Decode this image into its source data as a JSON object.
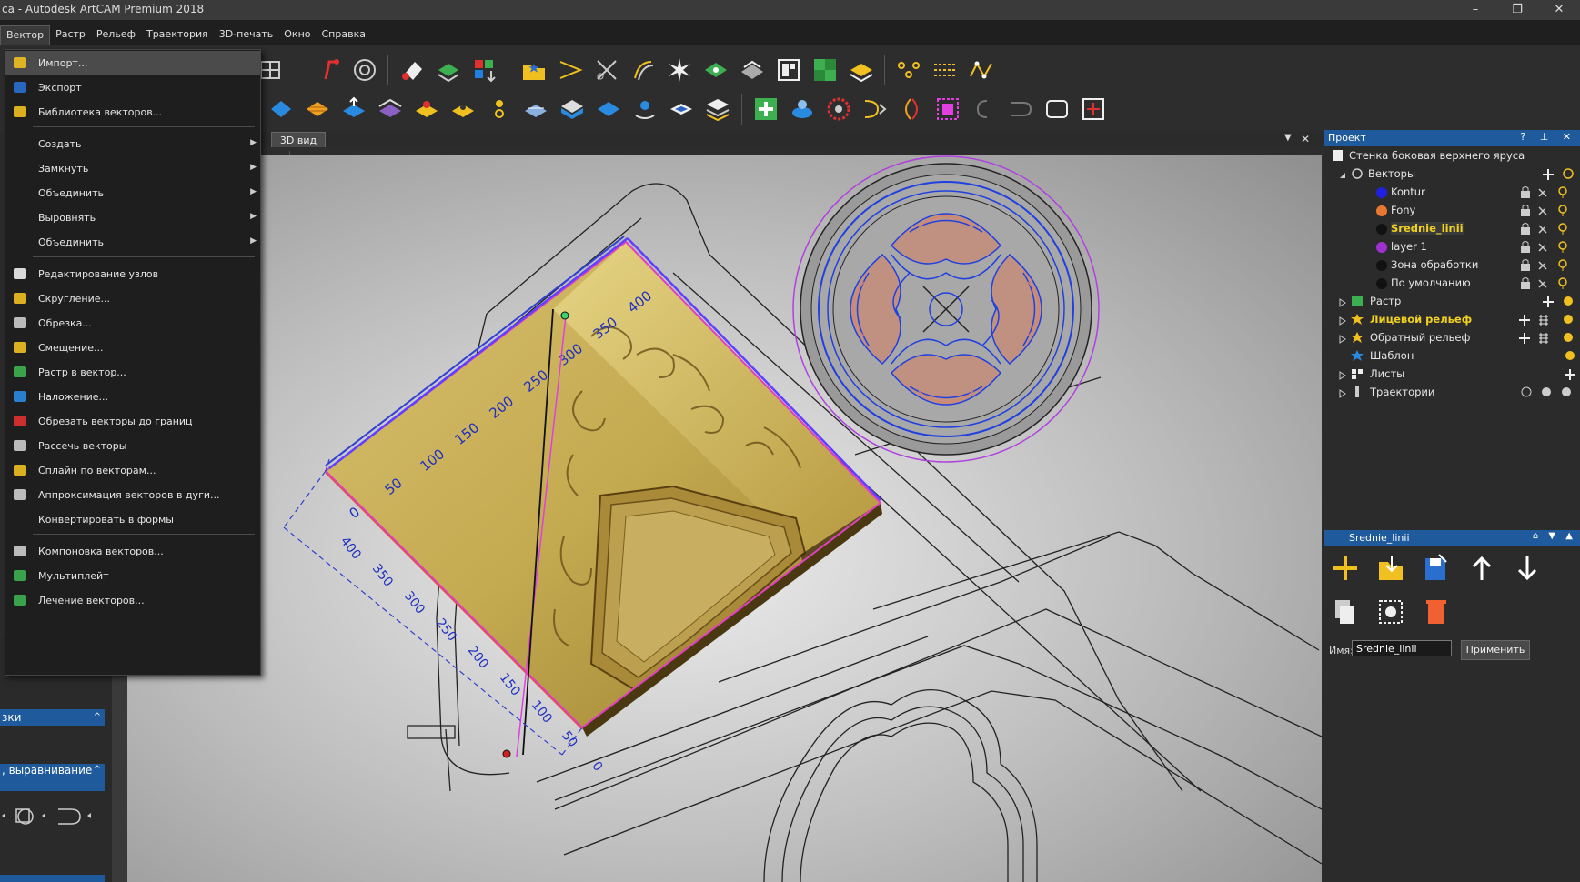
{
  "window": {
    "title": "ca - Autodesk ArtCAM Premium 2018",
    "controls": [
      "–",
      "❐",
      "✕"
    ]
  },
  "menubar": {
    "items": [
      "Вектор",
      "Растр",
      "Рельеф",
      "Траектория",
      "3D-печать",
      "Окно",
      "Справка"
    ]
  },
  "dropdown": {
    "groups": [
      [
        "Импорт...",
        "Экспорт",
        "Библиотека векторов..."
      ],
      [
        "Создать",
        "Замкнуть",
        "Объединить",
        "Выровнять",
        "Объединить"
      ],
      [
        "Редактирование узлов",
        "Скругление...",
        "Обрезка...",
        "Смещение...",
        "Растр в вектор...",
        "Наложение...",
        "Обрезать векторы до границ",
        "Рассечь векторы",
        "Сплайн по векторам...",
        "Аппроксимация векторов в дуги...",
        "Конвертировать в формы"
      ],
      [
        "Компоновка векторов...",
        "Мультиплейт",
        "Лечение векторов..."
      ]
    ],
    "submenu_arrow": "▶"
  },
  "view": {
    "tab_label": "3D вид",
    "close": "✕",
    "dropdown": "▼"
  },
  "ruler": {
    "top_ticks": [
      "0",
      "50",
      "100",
      "150",
      "200",
      "250",
      "300",
      "350",
      "400"
    ],
    "bottom_ticks": [
      "400",
      "350",
      "300",
      "250",
      "200",
      "150",
      "100",
      "50",
      "0"
    ]
  },
  "left_panel": {
    "headers": [
      "зки",
      ", выравнивание"
    ],
    "chevron": "^"
  },
  "project_panel": {
    "title": "Проект",
    "header_buttons": "? ⊥ ✕",
    "root": "Стенка боковая верхнего яруса",
    "vectors_label": "Векторы",
    "layers": [
      {
        "name": "Kontur",
        "color": "#2020e0"
      },
      {
        "name": "Fony",
        "color": "#e87830"
      },
      {
        "name": "Srednie_linii",
        "color": "#111111"
      },
      {
        "name": "layer 1",
        "color": "#a030d0"
      },
      {
        "name": "Зона обработки",
        "color": "#111111"
      },
      {
        "name": "По умолчанию",
        "color": "#111111"
      }
    ],
    "other_nodes": [
      "Растр",
      "Лицевой рельеф",
      "Обратный рельеф",
      "Шаблон",
      "Листы",
      "Траектории"
    ]
  },
  "layer_panel": {
    "title": "Srednie_linii",
    "name_label": "Имя:",
    "name_value": "Srednie_linii",
    "apply_label": "Применить"
  }
}
